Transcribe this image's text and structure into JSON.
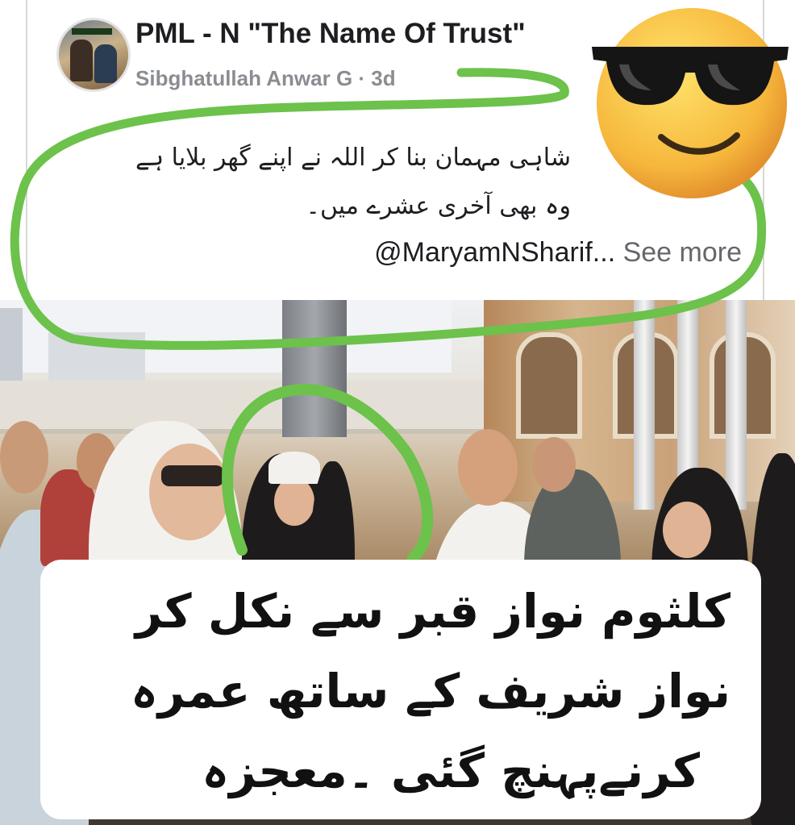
{
  "post": {
    "page_name": "PML - N \"The Name Of Trust\"",
    "author_meta": "Sibghatullah Anwar G · 3d",
    "urdu_line1": "شاہی مہمان بنا کر اللہ نے اپنے گھر بلایا ہے",
    "urdu_line2": "وہ بھی آخری عشرے میں۔",
    "mention": "@MaryamNSharif...",
    "see_more": " See more"
  },
  "caption": {
    "line1": "کلثوم نواز قبر سے نکل کر",
    "line2": "نواز شریف کے ساتھ عمرہ",
    "line3": "کرنےپہنچ گئی ۔معجزہ"
  },
  "colors": {
    "highlight_green": "#6cc24a",
    "see_more_grey": "#65676b",
    "meta_grey": "#8a8d91"
  },
  "icons": {
    "emoji": "sunglasses-face-icon",
    "avatar": "page-avatar-icon"
  }
}
